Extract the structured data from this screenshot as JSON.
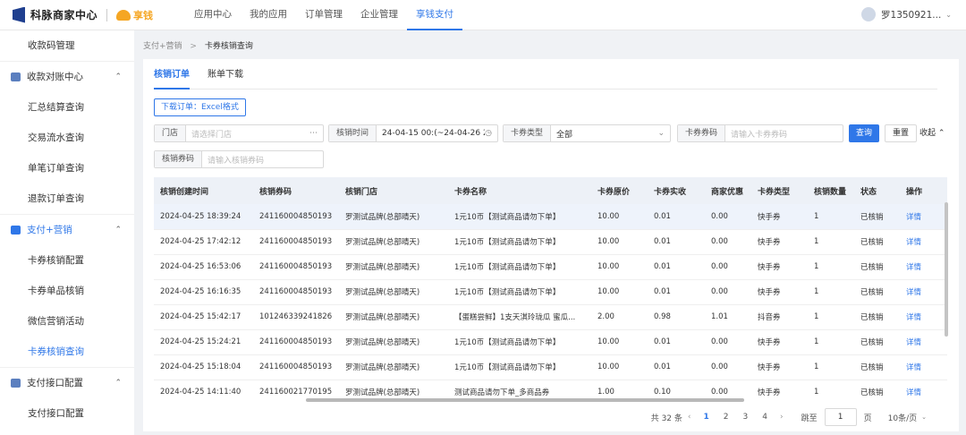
{
  "header": {
    "logo_text": "科脉商家中心",
    "brand2_text": "享钱",
    "nav": [
      "应用中心",
      "我的应用",
      "订单管理",
      "企业管理",
      "享钱支付"
    ],
    "user": "罗1350921..."
  },
  "sidebar": {
    "items": [
      {
        "label": "收款码管理"
      },
      {
        "label": "收款对账中心",
        "group": true
      },
      {
        "label": "汇总结算查询"
      },
      {
        "label": "交易流水查询"
      },
      {
        "label": "单笔订单查询"
      },
      {
        "label": "退款订单查询"
      },
      {
        "label": "支付+营销",
        "group": true
      },
      {
        "label": "卡券核销配置"
      },
      {
        "label": "卡券单品核销"
      },
      {
        "label": "微信营销活动"
      },
      {
        "label": "卡券核销查询"
      },
      {
        "label": "支付接口配置",
        "group": true
      },
      {
        "label": "支付接口配置"
      }
    ]
  },
  "breadcrumb": {
    "parent": "支付+营销",
    "current": "卡券核销查询"
  },
  "tabs": [
    "核销订单",
    "账单下载"
  ],
  "download_button": "下载订单：Excel格式",
  "filters": {
    "store_label": "门店",
    "store_placeholder": "请选择门店",
    "time_label": "核销时间",
    "time_value": "24-04-15 00:(~24-04-26 23:5",
    "card_type_label": "卡券类型",
    "card_type_value": "全部",
    "card_code_label": "卡券券码",
    "card_code_placeholder": "请输入卡券券码",
    "verify_code_label": "核销券码",
    "verify_code_placeholder": "请输入核销券码",
    "query_button": "查询",
    "reset_button": "重置",
    "collapse_label": "收起"
  },
  "table": {
    "columns": [
      "核销创建时间",
      "核销券码",
      "核销门店",
      "卡券名称",
      "卡券原价",
      "卡券实收",
      "商家优惠",
      "卡券类型",
      "核销数量",
      "状态",
      "操作"
    ],
    "rows": [
      [
        "2024-04-25 18:39:24",
        "241160004850193",
        "罗测试品牌(总部晴天)",
        "1元10币【测试商品请勿下单】",
        "10.00",
        "0.01",
        "0.00",
        "快手券",
        "1",
        "已核销",
        "详情"
      ],
      [
        "2024-04-25 17:42:12",
        "241160004850193",
        "罗测试品牌(总部晴天)",
        "1元10币【测试商品请勿下单】",
        "10.00",
        "0.01",
        "0.00",
        "快手券",
        "1",
        "已核销",
        "详情"
      ],
      [
        "2024-04-25 16:53:06",
        "241160004850193",
        "罗测试品牌(总部晴天)",
        "1元10币【测试商品请勿下单】",
        "10.00",
        "0.01",
        "0.00",
        "快手券",
        "1",
        "已核销",
        "详情"
      ],
      [
        "2024-04-25 16:16:35",
        "241160004850193",
        "罗测试品牌(总部晴天)",
        "1元10币【测试商品请勿下单】",
        "10.00",
        "0.01",
        "0.00",
        "快手券",
        "1",
        "已核销",
        "详情"
      ],
      [
        "2024-04-25 15:42:17",
        "101246339241826",
        "罗测试品牌(总部晴天)",
        "【蛋糕尝鲜】1支天淇玲珑瓜 蜜瓜...",
        "2.00",
        "0.98",
        "1.01",
        "抖音券",
        "1",
        "已核销",
        "详情"
      ],
      [
        "2024-04-25 15:24:21",
        "241160004850193",
        "罗测试品牌(总部晴天)",
        "1元10币【测试商品请勿下单】",
        "10.00",
        "0.01",
        "0.00",
        "快手券",
        "1",
        "已核销",
        "详情"
      ],
      [
        "2024-04-25 15:18:04",
        "241160004850193",
        "罗测试品牌(总部晴天)",
        "1元10币【测试商品请勿下单】",
        "10.00",
        "0.01",
        "0.00",
        "快手券",
        "1",
        "已核销",
        "详情"
      ],
      [
        "2024-04-25 14:11:40",
        "241160021770195",
        "罗测试品牌(总部晴天)",
        "测试商品请勿下单_多商品券",
        "1.00",
        "0.10",
        "0.00",
        "快手券",
        "1",
        "已核销",
        "详情"
      ]
    ]
  },
  "pagination": {
    "total": "共 32 条",
    "pages": [
      "1",
      "2",
      "3",
      "4"
    ],
    "current": "1",
    "jump_label": "跳至",
    "jump_value": "1",
    "page_suffix": "页",
    "page_size": "10条/页"
  },
  "colors": {
    "accent": "#2f77e8",
    "brand": "#f5a623",
    "logo": "#1f3f8f"
  }
}
